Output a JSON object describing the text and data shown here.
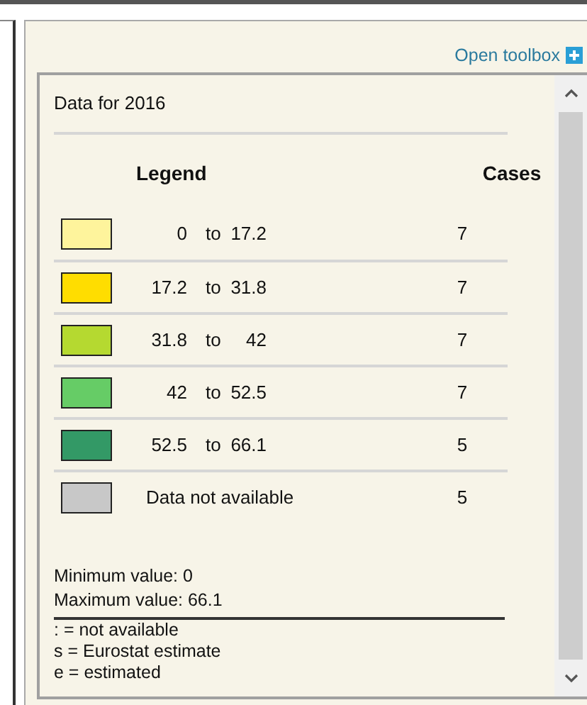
{
  "toolbox_link": {
    "label": "Open toolbox"
  },
  "legend_panel": {
    "title": "Data for 2016",
    "columns": [
      "Legend",
      "Cases"
    ],
    "rows": [
      {
        "kind": "range",
        "color": "#fef49c",
        "low": "0",
        "joiner": "to",
        "high": "17.2",
        "cases": "7"
      },
      {
        "kind": "range",
        "color": "#ffdd00",
        "low": "17.2",
        "joiner": "to",
        "high": "31.8",
        "cases": "7"
      },
      {
        "kind": "range",
        "color": "#b5d930",
        "low": "31.8",
        "joiner": "to",
        "high": "42",
        "cases": "7"
      },
      {
        "kind": "range",
        "color": "#66cc66",
        "low": "42",
        "joiner": "to",
        "high": "52.5",
        "cases": "7"
      },
      {
        "kind": "range",
        "color": "#339966",
        "low": "52.5",
        "joiner": "to",
        "high": "66.1",
        "cases": "5"
      },
      {
        "kind": "missing",
        "color": "#c8c8c8",
        "label": "Data not available",
        "cases": "5"
      }
    ],
    "stats": [
      "Minimum value: 0",
      "Maximum value: 66.1"
    ],
    "flags": [
      ": = not available",
      "s = Eurostat estimate",
      "e = estimated"
    ]
  }
}
